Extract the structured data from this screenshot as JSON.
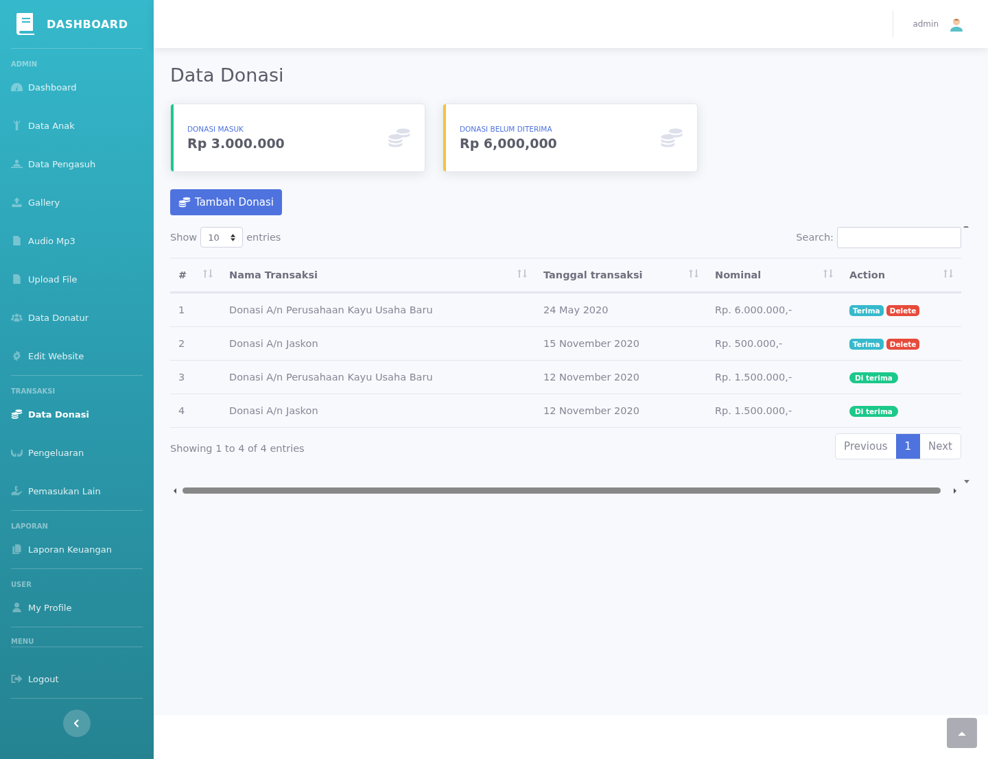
{
  "sidebar": {
    "brand": "DASHBOARD",
    "sections": [
      {
        "heading": "ADMIN",
        "kind": "plain",
        "items": [
          {
            "label": "Dashboard",
            "selected": false
          },
          {
            "label": "Data Anak",
            "selected": false
          },
          {
            "label": "Data Pengasuh",
            "selected": false
          },
          {
            "label": "Gallery",
            "selected": false
          },
          {
            "label": "Audio Mp3",
            "selected": false
          },
          {
            "label": "Upload File",
            "selected": false
          },
          {
            "label": "Data Donatur",
            "selected": false
          },
          {
            "label": "Edit Website",
            "selected": false
          }
        ]
      },
      {
        "heading": "TRANSAKSI",
        "kind": "plain",
        "items": [
          {
            "label": "Data Donasi",
            "selected": true
          },
          {
            "label": "Pengeluaran",
            "selected": false
          },
          {
            "label": "Pemasukan Lain",
            "selected": false
          }
        ]
      },
      {
        "heading": "LAPORAN",
        "kind": "plain",
        "items": [
          {
            "label": "Laporan Keuangan",
            "selected": false
          }
        ]
      },
      {
        "heading": "USER",
        "kind": "plain",
        "items": [
          {
            "label": "My Profile",
            "selected": false
          }
        ]
      },
      {
        "heading": "MENU",
        "kind": "split",
        "items": [
          {
            "label": "Logout",
            "selected": false
          }
        ]
      }
    ]
  },
  "topbar": {
    "user": "admin"
  },
  "page_title": "Data Donasi",
  "cards": [
    {
      "label": "DONASI MASUK",
      "value": "Rp 3.000.000",
      "color": "#1cc88a"
    },
    {
      "label": "DONASI BELUM DITERIMA",
      "value": "Rp 6,000,000",
      "color": "#f6c23e"
    }
  ],
  "add_button": "Tambah Donasi",
  "table_controls": {
    "show_label": "Show",
    "page_size": "10",
    "entries_label": "entries",
    "search_label": "Search:"
  },
  "table": {
    "columns": [
      "#",
      "Nama Transaksi",
      "Tanggal transaksi",
      "Nominal",
      "Action"
    ],
    "rows": [
      {
        "cells": [
          "1",
          "Donasi A/n Perusahaan Kayu Usaha Baru",
          "24 May 2020",
          "Rp. 6.000.000,-"
        ],
        "actions": [
          {
            "label": "Terima",
            "kind": "info"
          },
          {
            "label": "Delete",
            "kind": "danger"
          }
        ]
      },
      {
        "cells": [
          "2",
          "Donasi A/n Jaskon",
          "15 November 2020",
          "Rp. 500.000,-"
        ],
        "actions": [
          {
            "label": "Terima",
            "kind": "info"
          },
          {
            "label": "Delete",
            "kind": "danger"
          }
        ]
      },
      {
        "cells": [
          "3",
          "Donasi A/n Perusahaan Kayu Usaha Baru",
          "12 November 2020",
          "Rp. 1.500.000,-"
        ],
        "actions": [
          {
            "label": "Di terima",
            "kind": "success"
          }
        ]
      },
      {
        "cells": [
          "4",
          "Donasi A/n Jaskon",
          "12 November 2020",
          "Rp. 1.500.000,-"
        ],
        "actions": [
          {
            "label": "Di terima",
            "kind": "success"
          }
        ]
      }
    ]
  },
  "table_info": "Showing 1 to 4 of 4 entries",
  "pagination": [
    {
      "label": "Previous",
      "selected": false
    },
    {
      "label": "1",
      "selected": true
    },
    {
      "label": "Next",
      "selected": false
    }
  ]
}
